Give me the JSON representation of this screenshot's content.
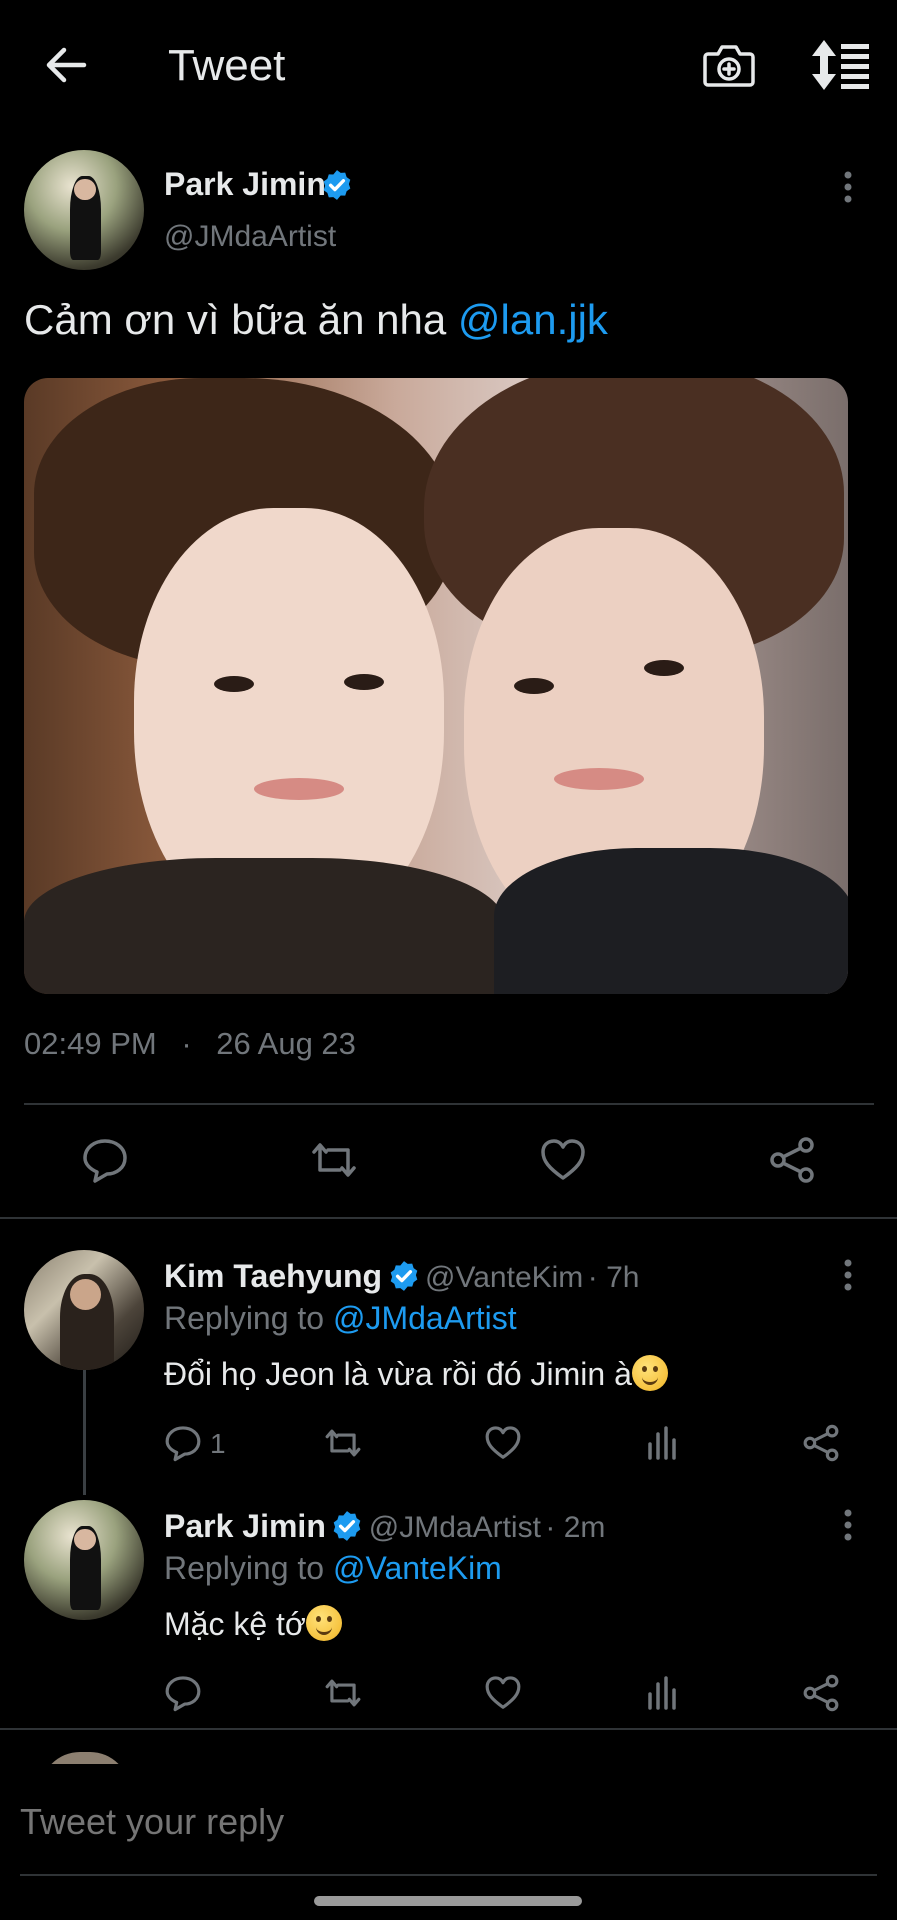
{
  "header": {
    "title": "Tweet",
    "back_icon": "arrow-left-icon",
    "camera_icon": "camera-plus-icon",
    "sort_icon": "sort-icon"
  },
  "main_tweet": {
    "author_name": "Park Jimin",
    "author_handle": "@JMdaArtist",
    "text_prefix": "Cảm ơn vì bữa ăn nha ",
    "text_mention": "@lan.jjk",
    "time": "02:49 PM",
    "separator": "·",
    "date": "26 Aug 23",
    "actions": [
      "reply-icon",
      "retweet-icon",
      "like-icon",
      "share-icon"
    ]
  },
  "replies": [
    {
      "author_name": "Kim Taehyung",
      "author_handle": "@VanteKim",
      "time_ago": "· 7h",
      "replying_prefix": "Replying to",
      "replying_to": "@JMdaArtist",
      "text": "Đổi họ Jeon là vừa rồi đó Jimin à",
      "reply_count": "1"
    },
    {
      "author_name": "Park Jimin",
      "author_handle": "@JMdaArtist",
      "time_ago": "· 2m",
      "replying_prefix": "Replying to",
      "replying_to": "@VanteKim",
      "text": "Mặc kệ tớ",
      "reply_count": ""
    }
  ],
  "reply_input": {
    "placeholder": "Tweet your reply"
  },
  "colors": {
    "background": "#000000",
    "text": "#e7e9ea",
    "muted": "#71767b",
    "accent": "#1d9bf0",
    "divider": "#2f3336"
  }
}
